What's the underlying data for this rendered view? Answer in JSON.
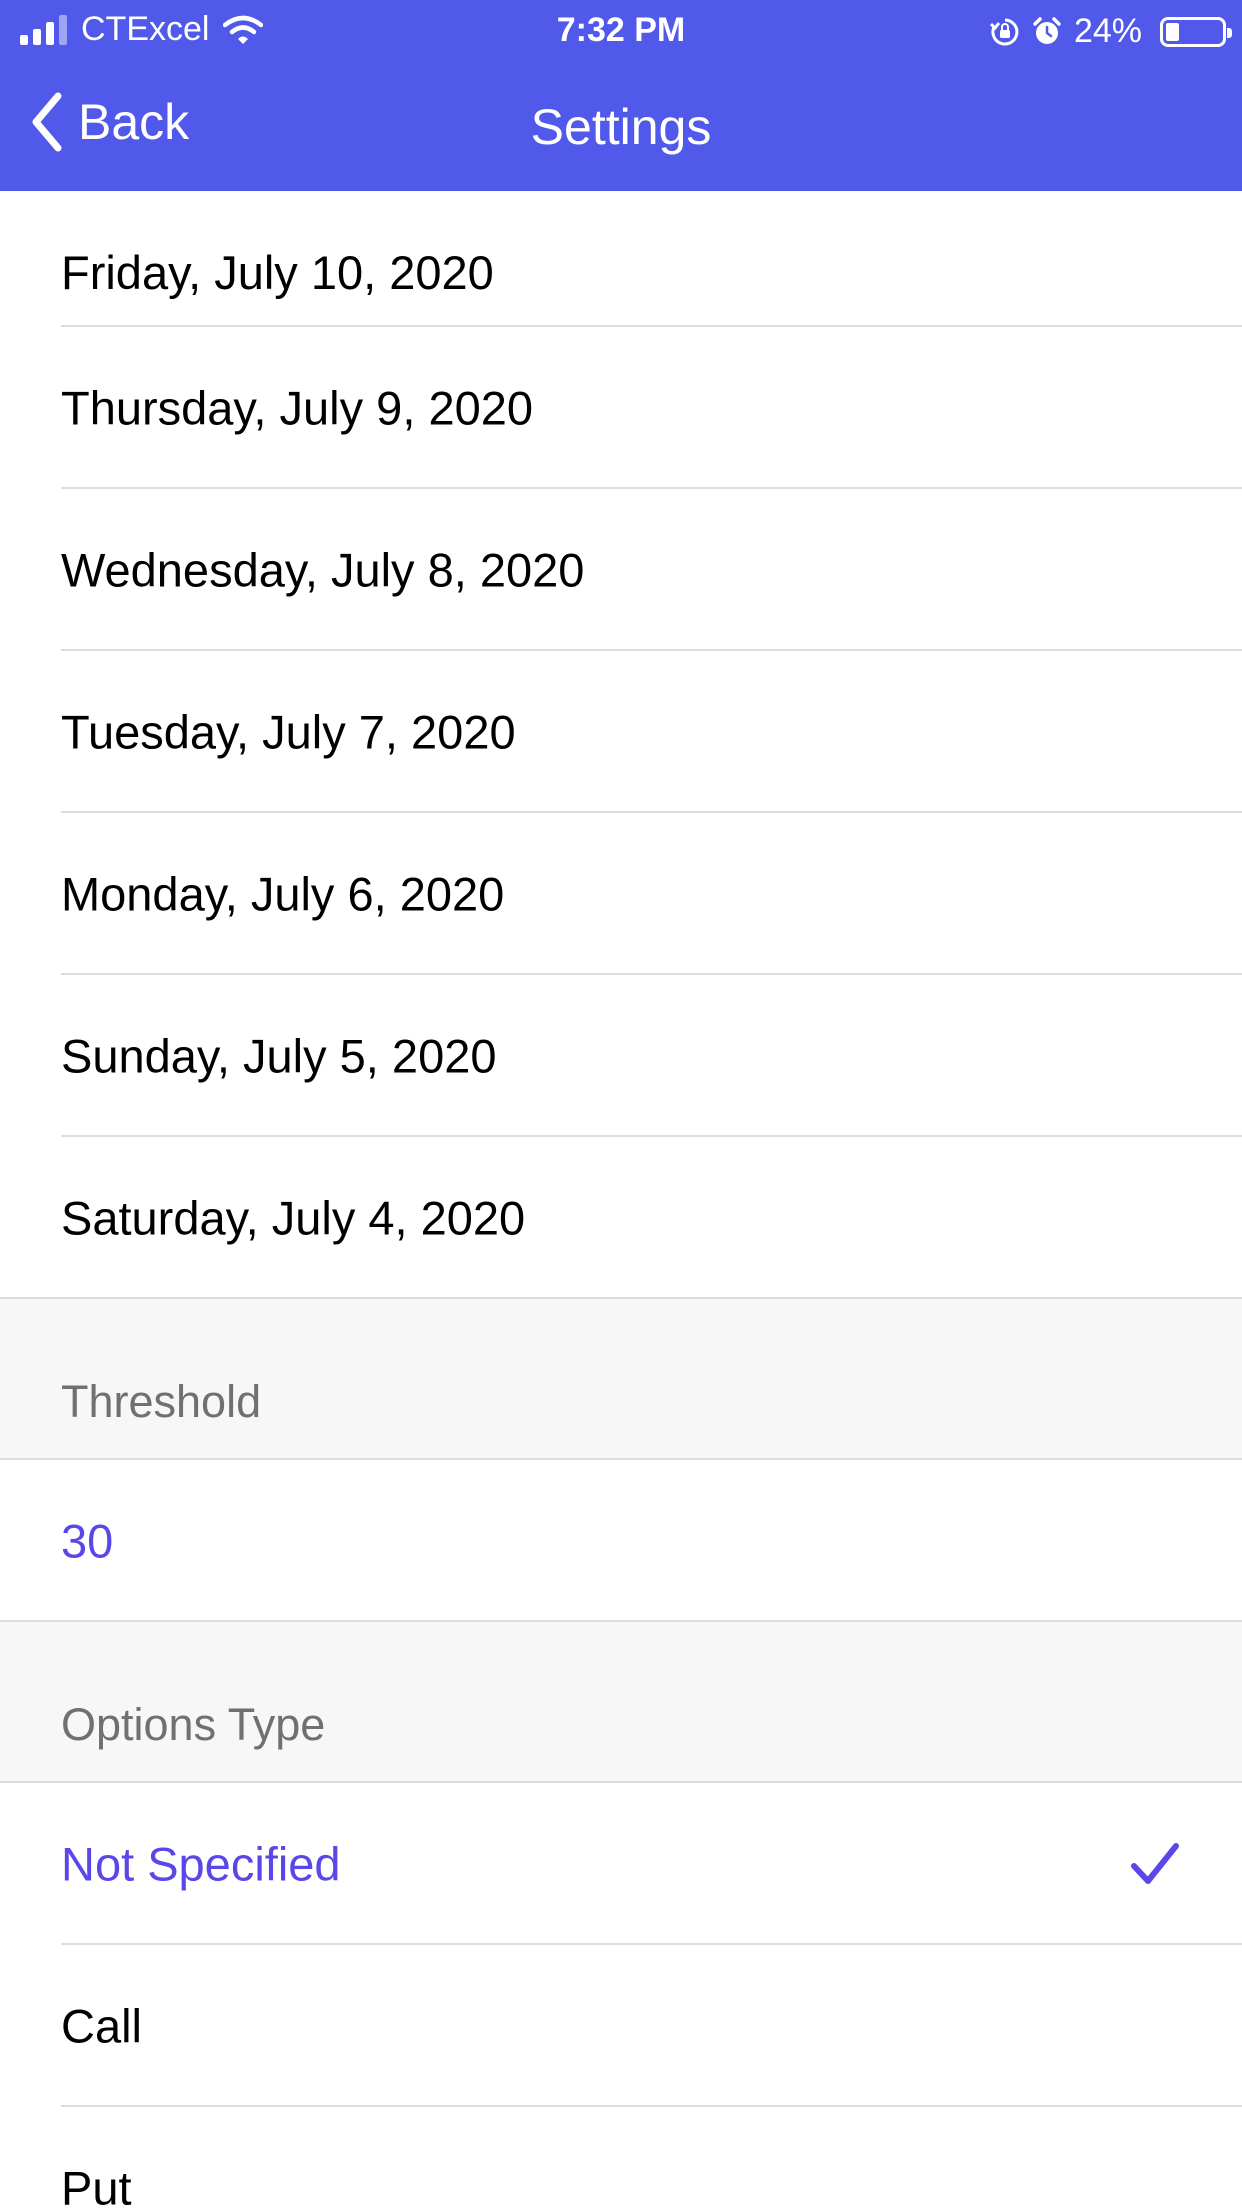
{
  "status_bar": {
    "carrier": "CTExcel",
    "time": "7:32 PM",
    "battery": "24%",
    "battery_level": 0.24,
    "icons": [
      "signal-icon",
      "wifi-icon",
      "rotation-lock-icon",
      "alarm-icon",
      "battery-icon"
    ]
  },
  "nav": {
    "back_label": "Back",
    "title": "Settings"
  },
  "dates": [
    "Friday, July 10, 2020",
    "Thursday, July 9, 2020",
    "Wednesday, July 8, 2020",
    "Tuesday, July 7, 2020",
    "Monday, July 6, 2020",
    "Sunday, July 5, 2020",
    "Saturday, July 4, 2020"
  ],
  "threshold": {
    "header": "Threshold",
    "value": "30"
  },
  "options_type": {
    "header": "Options Type",
    "items": [
      "Not Specified",
      "Call",
      "Put"
    ],
    "selected": "Not Specified"
  },
  "colors": {
    "accent": "#5159ea",
    "selected_text": "#5a47e8",
    "section_bg": "#f7f7f7",
    "section_text": "#707070"
  }
}
